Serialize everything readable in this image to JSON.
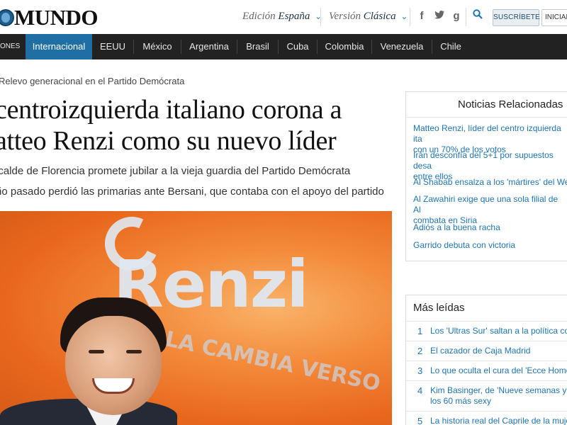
{
  "header": {
    "logo_text": "MUNDO",
    "edition_label": "Edición",
    "edition_value": "España",
    "version_label": "Versión",
    "version_value": "Clásica",
    "subscribe_label": "SUSCRÍBETE",
    "login_label": "INICIAR SESIÓN"
  },
  "nav": {
    "items": [
      {
        "label": "ONES",
        "active": false
      },
      {
        "label": "Internacional",
        "active": true
      },
      {
        "label": "EEUU",
        "active": false
      },
      {
        "label": "México",
        "active": false
      },
      {
        "label": "Argentina",
        "active": false
      },
      {
        "label": "Brasil",
        "active": false
      },
      {
        "label": "Cuba",
        "active": false
      },
      {
        "label": "Colombia",
        "active": false
      },
      {
        "label": "Venezuela",
        "active": false
      },
      {
        "label": "Chile",
        "active": false
      }
    ]
  },
  "article": {
    "kicker": "Relevo generacional en el Partido Demócrata",
    "headline": "centroizquierda italiano corona a atteo Renzi como su nuevo líder",
    "subtitles": [
      "lcalde de Florencia promete jubilar a la vieja guardia del Partido Demócrata",
      "ño pasado perdió las primarias ante Bersani, que contaba con el apoyo del partido"
    ],
    "photo_text": "Renzi",
    "photo_slogan": "LA CAMBIA VERSO"
  },
  "related": {
    "title": "Noticias Relacionadas",
    "items": [
      "Matteo Renzi, líder del centro izquierda ita / con un 70% de los votos",
      "Irán desconfía del 5+1 por supuestos desa / entre ellos",
      "Al Shabab ensalza a los 'mártires' del We",
      "Al Zawahiri exige que una sola filial de Al / combata en Siria",
      "Adiós a la buena racha",
      "Garrido debuta con victoria"
    ]
  },
  "most_read": {
    "title": "Más leídas",
    "items": [
      {
        "num": "1",
        "text": "Los 'Ultras Sur' saltan a la política co"
      },
      {
        "num": "2",
        "text": "El cazador de Caja Madrid"
      },
      {
        "num": "3",
        "text": "Lo que oculta el cura del 'Ecce Homo"
      },
      {
        "num": "4",
        "text": "Kim Basinger, de 'Nueve semanas y / los 60 más sexy"
      },
      {
        "num": "5",
        "text": "La historia real del Caprile de la muje"
      }
    ]
  },
  "icons": {
    "facebook": "f",
    "twitter": "twitter-bird",
    "googleplus": "g",
    "search": "search-icon"
  },
  "colors": {
    "nav_bg": "#222222",
    "nav_active": "#1f6fa5",
    "link": "#1f74b3",
    "subscribe_bg": "#e9eef2"
  }
}
